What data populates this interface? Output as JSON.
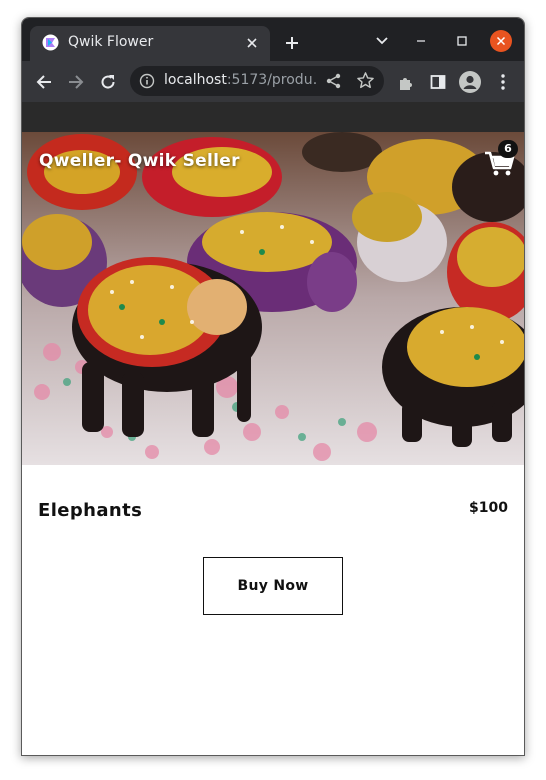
{
  "browser": {
    "tab_title": "Qwik Flower",
    "url_host": "localhost",
    "url_rest": ":5173/produ…"
  },
  "header": {
    "site_title": "Qweller- Qwik Seller",
    "cart_count": "6"
  },
  "product": {
    "name": "Elephants",
    "price": "$100",
    "buy_label": "Buy Now"
  },
  "colors": {
    "chrome_dark": "#202124",
    "chrome_tab": "#35363a",
    "close_button": "#e95420",
    "text_dark": "#111111"
  },
  "icons": [
    "qwik-favicon-icon",
    "close-tab-icon",
    "new-tab-icon",
    "tab-search-icon",
    "minimize-icon",
    "maximize-icon",
    "window-close-icon",
    "back-icon",
    "forward-icon",
    "reload-icon",
    "info-icon",
    "share-icon",
    "star-icon",
    "extensions-icon",
    "side-panel-icon",
    "profile-icon",
    "menu-icon",
    "cart-icon"
  ]
}
